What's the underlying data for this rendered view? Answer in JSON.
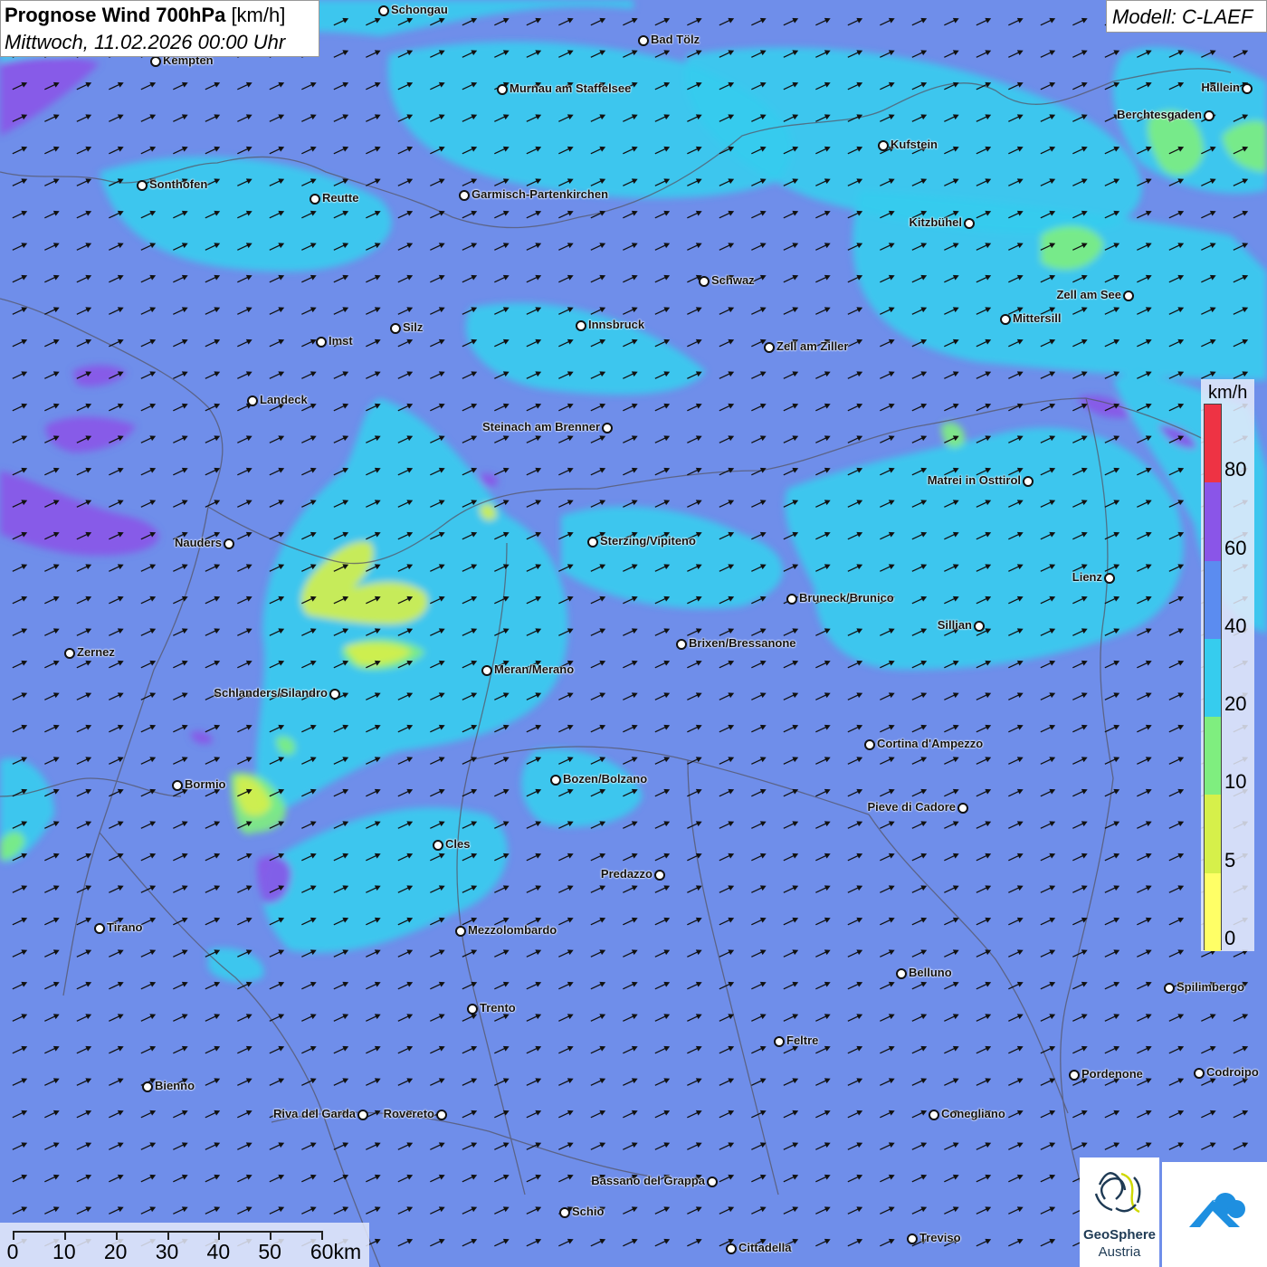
{
  "header": {
    "title_bold": "Prognose Wind 700hPa",
    "title_unit": "[km/h]",
    "datetime": "Mittwoch, 11.02.2026 00:00 Uhr"
  },
  "model": {
    "label": "Modell: C-LAEF"
  },
  "legend": {
    "unit": "km/h",
    "ticks": [
      "0",
      "5",
      "10",
      "20",
      "40",
      "60",
      "80"
    ],
    "colors": [
      "#ffff66",
      "#d6f04a",
      "#7fee7f",
      "#36ccee",
      "#5b8cf0",
      "#8a55e8",
      "#ee3344"
    ]
  },
  "wind": {
    "arrow_color": "#111111",
    "direction": "south-west"
  },
  "scale_bar": {
    "labels": [
      "0",
      "10",
      "20",
      "30",
      "40",
      "50",
      "60km"
    ]
  },
  "branding": {
    "name": "GeoSphere",
    "sub": "Austria"
  },
  "cities": [
    {
      "name": "Schongau"
    },
    {
      "name": "Bad Tölz"
    },
    {
      "name": "Kempten"
    },
    {
      "name": "Murnau am Staffelsee"
    },
    {
      "name": "Hallein"
    },
    {
      "name": "Berchtesgaden"
    },
    {
      "name": "Kufstein"
    },
    {
      "name": "Sonthofen"
    },
    {
      "name": "Reutte"
    },
    {
      "name": "Garmisch-Partenkirchen"
    },
    {
      "name": "Kitzbühel"
    },
    {
      "name": "Schwaz"
    },
    {
      "name": "Zell am See"
    },
    {
      "name": "Mittersill"
    },
    {
      "name": "Innsbruck"
    },
    {
      "name": "Silz"
    },
    {
      "name": "Imst"
    },
    {
      "name": "Zell am Ziller"
    },
    {
      "name": "Landeck"
    },
    {
      "name": "Steinach am Brenner"
    },
    {
      "name": "Matrei in Osttirol"
    },
    {
      "name": "Nauders"
    },
    {
      "name": "Sterzing/Vipiteno"
    },
    {
      "name": "Lienz"
    },
    {
      "name": "Bruneck/Brunico"
    },
    {
      "name": "Sillian"
    },
    {
      "name": "Zernez"
    },
    {
      "name": "Brixen/Bressanone"
    },
    {
      "name": "Meran/Merano"
    },
    {
      "name": "Schlanders/Silandro"
    },
    {
      "name": "Cortina d'Ampezzo"
    },
    {
      "name": "Bormio"
    },
    {
      "name": "Bozen/Bolzano"
    },
    {
      "name": "Pieve di Cadore"
    },
    {
      "name": "Cles"
    },
    {
      "name": "Predazzo"
    },
    {
      "name": "Tirano"
    },
    {
      "name": "Mezzolombardo"
    },
    {
      "name": "Belluno"
    },
    {
      "name": "Spilimbergo"
    },
    {
      "name": "Trento"
    },
    {
      "name": "Feltre"
    },
    {
      "name": "Pordenone"
    },
    {
      "name": "Codroipo"
    },
    {
      "name": "Bienno"
    },
    {
      "name": "Riva del Garda"
    },
    {
      "name": "Rovereto"
    },
    {
      "name": "Conegliano"
    },
    {
      "name": "Bassano del Grappa"
    },
    {
      "name": "Schio"
    },
    {
      "name": "Treviso"
    },
    {
      "name": "Cittadella"
    }
  ]
}
